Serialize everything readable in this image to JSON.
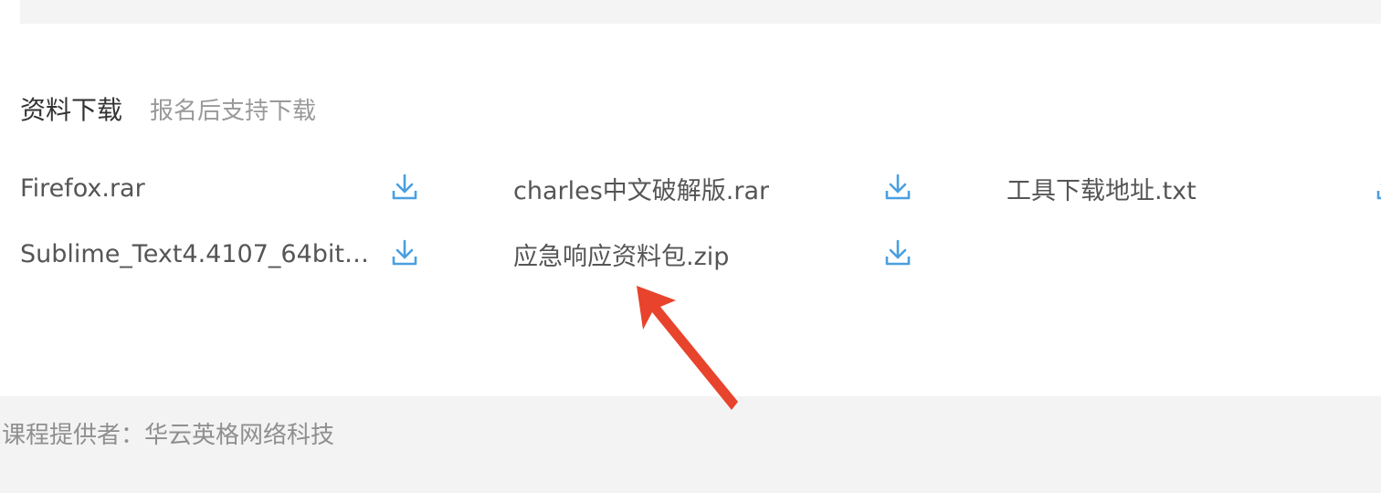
{
  "section": {
    "title": "资料下载",
    "subtitle": "报名后支持下载"
  },
  "files": [
    {
      "name": "Firefox.rar",
      "icon": "download-icon"
    },
    {
      "name": "charles中文破解版.rar",
      "icon": "download-icon"
    },
    {
      "name": "工具下载地址.txt",
      "icon": "download-icon"
    },
    {
      "name": "Sublime_Text4.4107_64bit…",
      "icon": "download-icon"
    },
    {
      "name": "应急响应资料包.zip",
      "icon": "download-icon"
    }
  ],
  "footer": {
    "provider_text": "课程提供者：华云英格网络科技"
  },
  "colors": {
    "icon_blue": "#4a9fe0",
    "annotation_arrow": "#e8432c"
  }
}
